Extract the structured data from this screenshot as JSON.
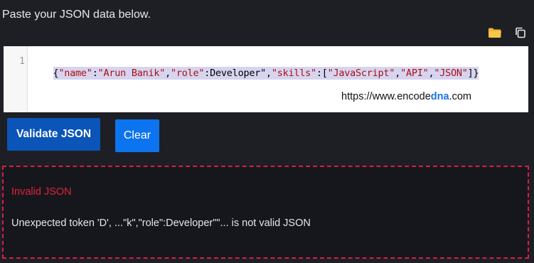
{
  "prompt": "Paste your JSON data below.",
  "toolbar": {
    "open_icon": "folder-icon",
    "copy_icon": "copy-icon",
    "folder_color": "#f2b632"
  },
  "editor": {
    "line_number": "1",
    "tokens": [
      {
        "t": "{",
        "k": "punc"
      },
      {
        "t": "\"name\"",
        "k": "str"
      },
      {
        "t": ":",
        "k": "punc"
      },
      {
        "t": "\"Arun Banik\"",
        "k": "str"
      },
      {
        "t": ",",
        "k": "punc"
      },
      {
        "t": "\"role\"",
        "k": "str"
      },
      {
        "t": ":Developer\",",
        "k": "plain"
      },
      {
        "t": "\"skills\"",
        "k": "str"
      },
      {
        "t": ":[",
        "k": "punc"
      },
      {
        "t": "\"JavaScript\"",
        "k": "str"
      },
      {
        "t": ",",
        "k": "punc"
      },
      {
        "t": "\"API\"",
        "k": "str"
      },
      {
        "t": ",",
        "k": "punc"
      },
      {
        "t": "\"JSON\"",
        "k": "str"
      },
      {
        "t": "]}",
        "k": "punc"
      }
    ],
    "watermark_prefix": "https://www.encode",
    "watermark_accent": "dna",
    "watermark_suffix": ".com"
  },
  "buttons": {
    "validate": "Validate JSON",
    "clear": "Clear"
  },
  "error": {
    "title": "Invalid JSON",
    "message": "Unexpected token 'D', ...\"k\",\"role\":Developer\"\"... is not valid JSON"
  },
  "colors": {
    "background": "#1e1f24",
    "error_border": "#d61e45",
    "error_title": "#e0213a",
    "validate_button": "#0b55b8",
    "clear_button": "#0d74ef"
  }
}
